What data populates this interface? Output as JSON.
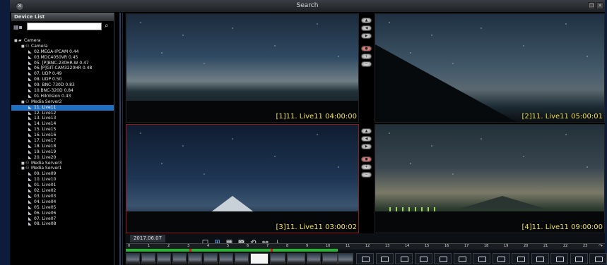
{
  "window": {
    "title": "Search"
  },
  "sidebar": {
    "header": "Device List",
    "search_value": "",
    "tree": [
      {
        "label": "Camera",
        "level": 0,
        "kind": "root",
        "icon": "folder-icon"
      },
      {
        "label": "Camera",
        "level": 1,
        "kind": "group",
        "icon": "group-icon"
      },
      {
        "label": "02.MEGA-IPCAM 0.44",
        "level": 2,
        "kind": "camera",
        "icon": "camera-icon"
      },
      {
        "label": "03.MDC4050VR 0.45",
        "level": 2,
        "kind": "camera",
        "icon": "camera-icon"
      },
      {
        "label": "05. [P]BNC-230HR-W 0.47",
        "level": 2,
        "kind": "camera",
        "icon": "camera-icon"
      },
      {
        "label": "06.[P]GIT-CAM3220HR 0.48",
        "level": 2,
        "kind": "camera",
        "icon": "camera-icon"
      },
      {
        "label": "07. UDP 0.49",
        "level": 2,
        "kind": "camera",
        "icon": "camera-icon"
      },
      {
        "label": "08. UDP 0.50",
        "level": 2,
        "kind": "camera",
        "icon": "camera-icon"
      },
      {
        "label": "09. BNC-730D 0.83",
        "level": 2,
        "kind": "camera",
        "icon": "camera-icon"
      },
      {
        "label": "10.BNC-320D 0.84",
        "level": 2,
        "kind": "camera",
        "icon": "camera-icon"
      },
      {
        "label": "01.HikVision 0.43",
        "level": 2,
        "kind": "camera",
        "icon": "camera-icon"
      },
      {
        "label": "Media Server2",
        "level": 1,
        "kind": "group",
        "icon": "group-icon"
      },
      {
        "label": "11. Live11",
        "level": 2,
        "kind": "camera",
        "icon": "camera-icon",
        "selected": true
      },
      {
        "label": "12. Live12",
        "level": 2,
        "kind": "camera",
        "icon": "camera-icon"
      },
      {
        "label": "13. Live13",
        "level": 2,
        "kind": "camera",
        "icon": "camera-icon"
      },
      {
        "label": "14. Live14",
        "level": 2,
        "kind": "camera",
        "icon": "camera-icon"
      },
      {
        "label": "15. Live15",
        "level": 2,
        "kind": "camera",
        "icon": "camera-icon"
      },
      {
        "label": "16. Live16",
        "level": 2,
        "kind": "camera",
        "icon": "camera-icon"
      },
      {
        "label": "17. Live17",
        "level": 2,
        "kind": "camera",
        "icon": "camera-icon"
      },
      {
        "label": "18. Live18",
        "level": 2,
        "kind": "camera",
        "icon": "camera-icon"
      },
      {
        "label": "19. Live19",
        "level": 2,
        "kind": "camera",
        "icon": "camera-icon"
      },
      {
        "label": "20. Live20",
        "level": 2,
        "kind": "camera",
        "icon": "camera-icon"
      },
      {
        "label": "Media Server3",
        "level": 1,
        "kind": "group",
        "icon": "group-icon"
      },
      {
        "label": "Media Server1",
        "level": 1,
        "kind": "group",
        "icon": "group-icon"
      },
      {
        "label": "09. Live09",
        "level": 2,
        "kind": "camera",
        "icon": "camera-icon"
      },
      {
        "label": "10. Live10",
        "level": 2,
        "kind": "camera",
        "icon": "camera-icon"
      },
      {
        "label": "01. Live01",
        "level": 2,
        "kind": "camera",
        "icon": "camera-icon"
      },
      {
        "label": "02. Live02",
        "level": 2,
        "kind": "camera",
        "icon": "camera-icon"
      },
      {
        "label": "03. Live03",
        "level": 2,
        "kind": "camera",
        "icon": "camera-icon"
      },
      {
        "label": "04. Live04",
        "level": 2,
        "kind": "camera",
        "icon": "camera-icon"
      },
      {
        "label": "05. Live05",
        "level": 2,
        "kind": "camera",
        "icon": "camera-icon"
      },
      {
        "label": "06. Live06",
        "level": 2,
        "kind": "camera",
        "icon": "camera-icon"
      },
      {
        "label": "07. Live07",
        "level": 2,
        "kind": "camera",
        "icon": "camera-icon"
      },
      {
        "label": "08. Live08",
        "level": 2,
        "kind": "camera",
        "icon": "camera-icon"
      }
    ]
  },
  "grid": {
    "cells": [
      {
        "osd": "[1]11. Live11 04:00:00"
      },
      {
        "osd": "[2]11. Live11 05:00:01"
      },
      {
        "osd": "[3]11. Live11 03:00:02"
      },
      {
        "osd": "[4]11. Live11 09:00:00"
      }
    ],
    "osd_color": "#f2e44a",
    "selected_border_color": "#8a1c1c"
  },
  "playback": {
    "date": "2017.06.07",
    "layout_buttons": [
      {
        "name": "layout-1x1-icon",
        "glyph": "□",
        "active": false
      },
      {
        "name": "layout-2x2-icon",
        "glyph": "⊞",
        "active": true
      },
      {
        "name": "layout-3x3-icon",
        "glyph": "▦",
        "active": false
      },
      {
        "name": "layout-4x4-icon",
        "glyph": "▩",
        "active": false
      },
      {
        "name": "sync-icon",
        "glyph": "⟲",
        "active": false
      },
      {
        "name": "link-icon",
        "glyph": "⚯",
        "active": false
      },
      {
        "name": "download-icon",
        "glyph": "⤓",
        "active": false
      }
    ],
    "hours": [
      "0",
      "1",
      "2",
      "3",
      "4",
      "5",
      "6",
      "7",
      "8",
      "9",
      "10",
      "11",
      "12",
      "13",
      "14",
      "15",
      "16",
      "17",
      "18",
      "19",
      "20",
      "21",
      "22",
      "23"
    ],
    "record_color": "#28b433",
    "marker_color": "#d12"
  }
}
